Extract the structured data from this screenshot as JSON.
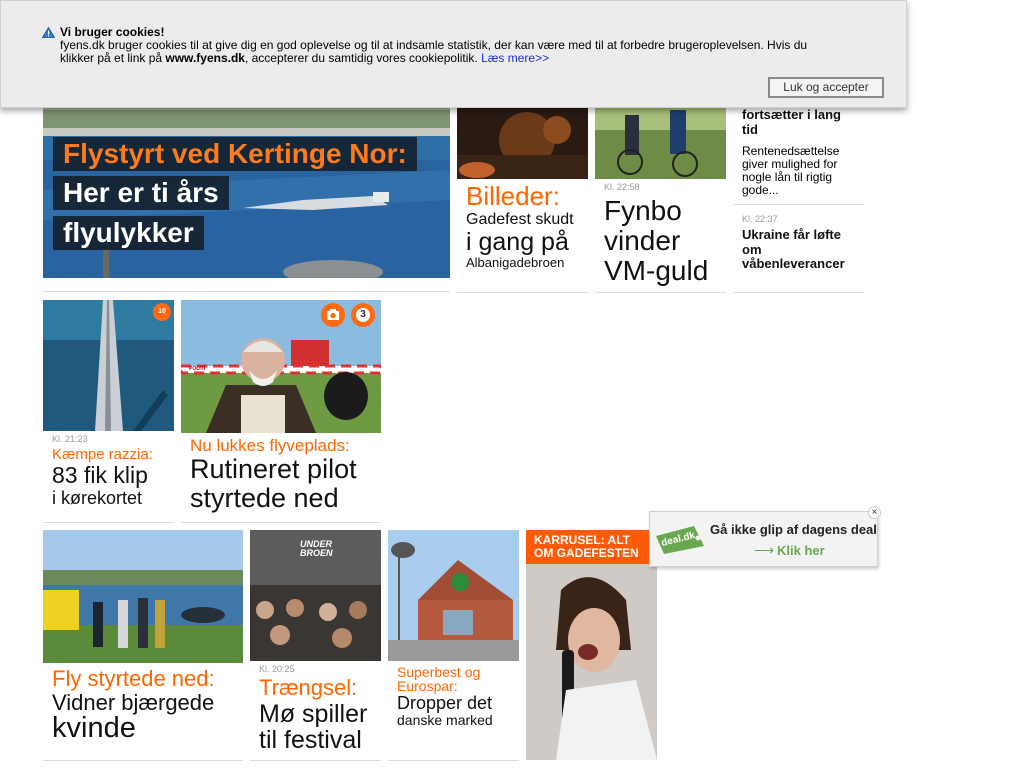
{
  "cookie_banner": {
    "title": "Vi bruger cookies!",
    "line1": "fyens.dk bruger cookies til at give dig en god oplevelse og til at indsamle statistik, der kan være med til at forbedre brugeroplevelsen. Hvis du",
    "line2_pre": "klikker på et link på ",
    "line2_bold": "www.fyens.dk",
    "line2_post": ", accepterer du samtidig vores cookiepolitik. ",
    "link": "Læs mere>>",
    "accept_button": "Luk og accepter"
  },
  "hero": {
    "kicker": "Flystyrt ved Kertinge Nor:",
    "line1": "Her er ti års",
    "line2": "flyulykker"
  },
  "card_billeder": {
    "kicker": "Billeder:",
    "line1": "Gadefest skudt",
    "line2": "i gang på",
    "line3": "Albanigadebroen"
  },
  "card_fynbo": {
    "time": "Kl. 22:58",
    "headline_lines": [
      "Fynbo",
      "vinder",
      "VM-guld"
    ]
  },
  "card_rente": {
    "headline_lines": [
      "fortsætter i lang",
      "tid"
    ],
    "body_lines": [
      "Rentenedsættelse",
      "giver mulighed for",
      "nogle lån til rigtig",
      "gode..."
    ]
  },
  "card_ukraine": {
    "time": "Kl. 22:37",
    "headline_lines": [
      "Ukraine får løfte",
      "om",
      "våbenleverancer"
    ]
  },
  "card_razzia": {
    "badge": "10",
    "time": "Kl. 21:23",
    "kicker": "Kæmpe razzia:",
    "line1": "83 fik klip",
    "line2": "i kørekortet"
  },
  "card_pilot": {
    "badge": "3",
    "police_tape": "POLITI",
    "kicker": "Nu lukkes flyveplads:",
    "line1": "Rutineret pilot",
    "line2": "styrtede ned"
  },
  "card_vidner": {
    "kicker": "Fly styrtede ned:",
    "line1": "Vidner bjærgede",
    "line2": "kvinde"
  },
  "card_moe": {
    "photo_sign": "UNDER BROEN",
    "time": "Kl. 20:25",
    "kicker": "Trængsel:",
    "line1": "Mø spiller",
    "line2": "til festival"
  },
  "card_superbest": {
    "kicker_lines": [
      "Superbest og",
      "Eurospar:"
    ],
    "line1": "Dropper det",
    "line2": "danske marked"
  },
  "card_karrusel": {
    "label_lines": [
      "KARRUSEL: ALT",
      "OM GADEFESTEN"
    ]
  },
  "deal_ad": {
    "logo": "deal.dk",
    "title": "Gå ikke glip af dagens deal",
    "cta": "Klik her",
    "close": "×"
  },
  "colors": {
    "accent": "#ff6600",
    "banner_bg": "#ececec",
    "link": "#1a2fcf",
    "deal_green": "#6aa84f"
  }
}
